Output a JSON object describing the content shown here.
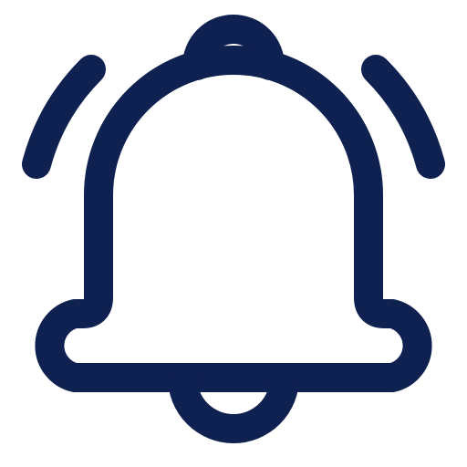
{
  "icon": {
    "name": "notification-bell-icon",
    "style": "outline",
    "color": "#0f2150",
    "background": "#ffffff"
  }
}
